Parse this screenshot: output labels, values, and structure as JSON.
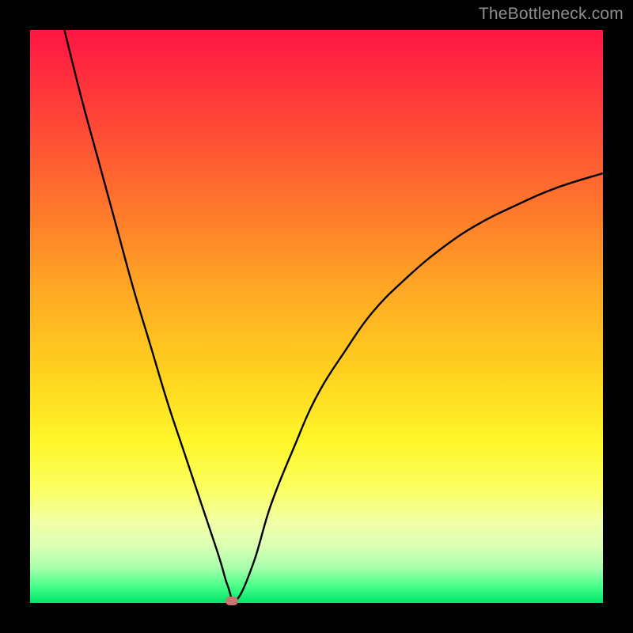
{
  "watermark": "TheBottleneck.com",
  "chart_data": {
    "type": "line",
    "title": "",
    "xlabel": "",
    "ylabel": "",
    "xlim": [
      0,
      100
    ],
    "ylim": [
      0,
      100
    ],
    "x": [
      6,
      9,
      12,
      15,
      18,
      21,
      24,
      27,
      30,
      33,
      34.5,
      36,
      39,
      42,
      46,
      50,
      55,
      60,
      66,
      72,
      78,
      85,
      92,
      100
    ],
    "y": [
      100,
      88,
      77,
      66,
      55,
      45,
      35,
      26,
      17,
      8,
      3,
      0.5,
      7,
      17,
      27,
      36,
      44,
      51,
      57,
      62,
      66,
      69.5,
      72.5,
      75
    ],
    "annotation_point": {
      "x": 35.2,
      "y": 0.4
    }
  },
  "colors": {
    "frame": "#000000",
    "curve": "#000000",
    "marker": "#c9746e",
    "watermark": "#8f8f8f",
    "gradient_top": "#ff1543",
    "gradient_bottom": "#00e56a"
  }
}
